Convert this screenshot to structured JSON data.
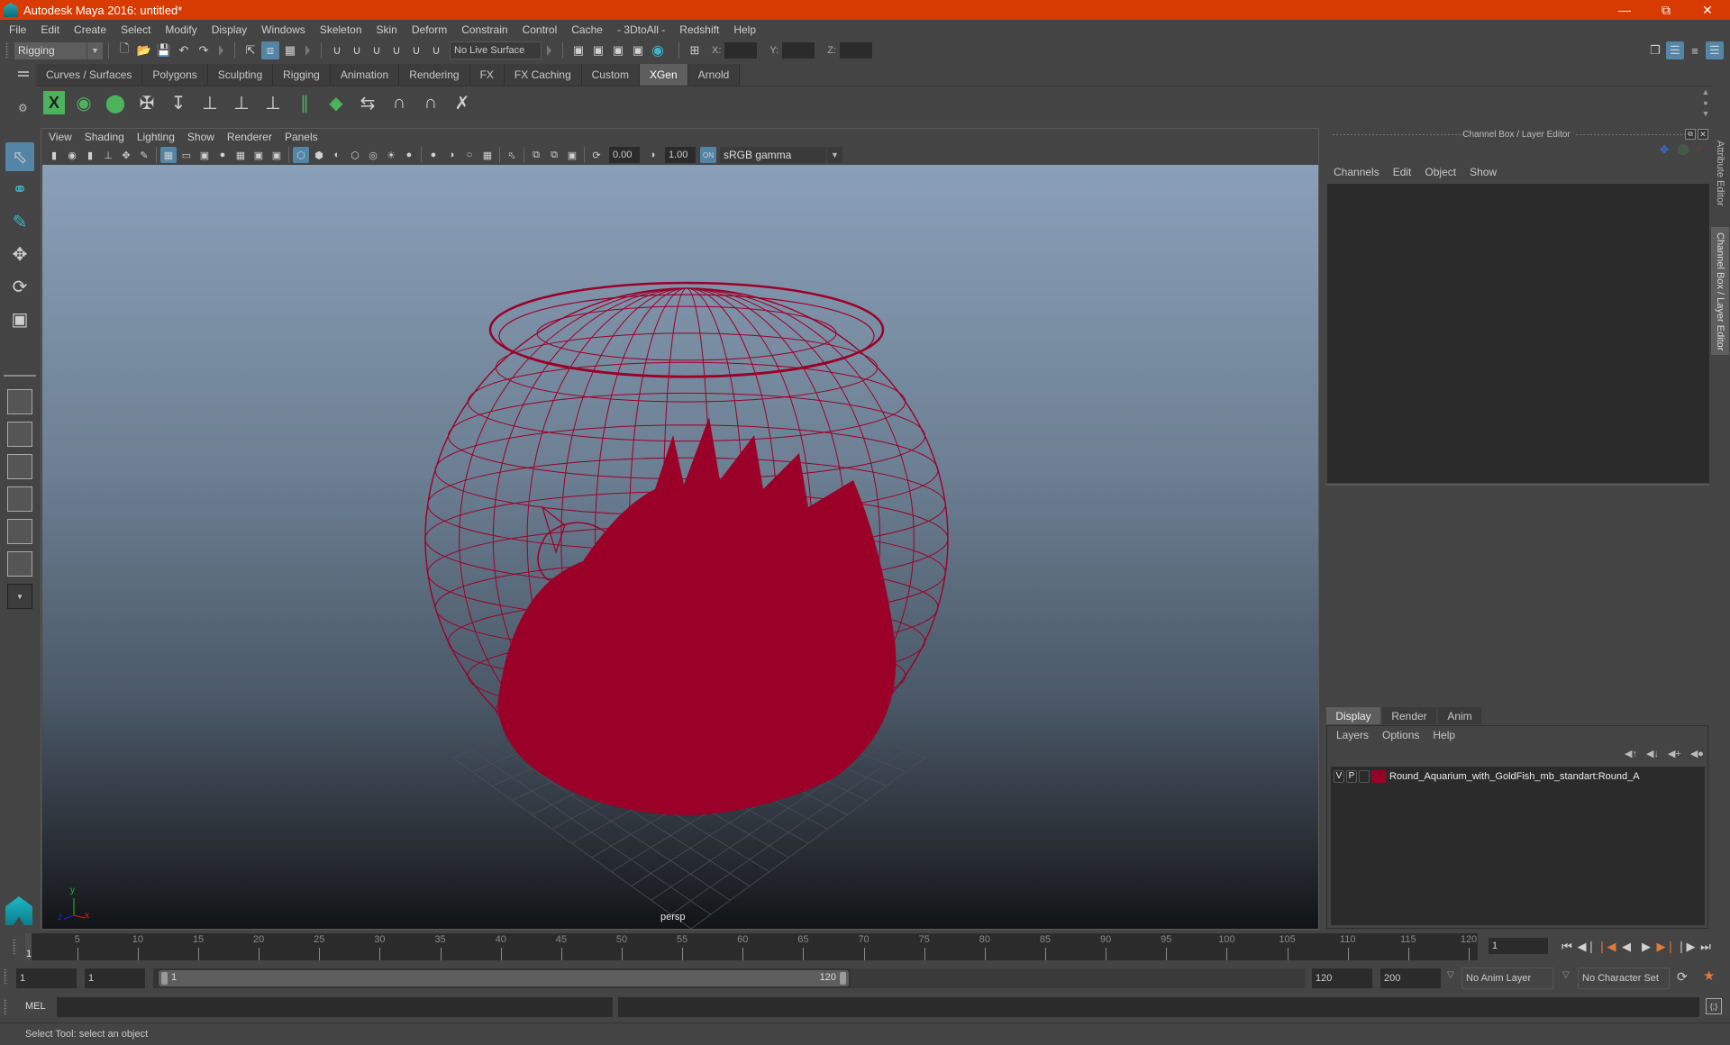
{
  "window": {
    "title": "Autodesk Maya 2016: untitled*",
    "controls": [
      "minimize",
      "restore",
      "close"
    ]
  },
  "menubar": [
    "File",
    "Edit",
    "Create",
    "Select",
    "Modify",
    "Display",
    "Windows",
    "Skeleton",
    "Skin",
    "Deform",
    "Constrain",
    "Control",
    "Cache",
    "- 3DtoAll -",
    "Redshift",
    "Help"
  ],
  "toolbar": {
    "menuset": "Rigging",
    "live_surface": "No Live Surface",
    "x_label": "X:",
    "y_label": "Y:",
    "z_label": "Z:",
    "x_value": "",
    "y_value": "",
    "z_value": ""
  },
  "shelf": {
    "tabs": [
      "Curves / Surfaces",
      "Polygons",
      "Sculpting",
      "Rigging",
      "Animation",
      "Rendering",
      "FX",
      "FX Caching",
      "Custom",
      "XGen",
      "Arnold"
    ],
    "active_tab": "XGen"
  },
  "viewport": {
    "menu": [
      "View",
      "Shading",
      "Lighting",
      "Show",
      "Renderer",
      "Panels"
    ],
    "exposure": "0.00",
    "gamma": "1.00",
    "color_space": "sRGB gamma",
    "camera_label": "persp",
    "axis_labels": {
      "x": "x",
      "y": "y",
      "z": "z"
    },
    "wireframe_color": "#9b0029",
    "scene_object": "Round aquarium with goldfish (wireframe)"
  },
  "channel_box": {
    "title": "Channel Box / Layer Editor",
    "menu": [
      "Channels",
      "Edit",
      "Object",
      "Show"
    ]
  },
  "layer_editor": {
    "tabs": [
      "Display",
      "Render",
      "Anim"
    ],
    "active_tab": "Display",
    "menu": [
      "Layers",
      "Options",
      "Help"
    ],
    "layers": [
      {
        "visible": "V",
        "playback": "P",
        "color": "#9b0029",
        "name": "Round_Aquarium_with_GoldFish_mb_standart:Round_A"
      }
    ]
  },
  "side_tabs": [
    "Attribute Editor",
    "Channel Box / Layer Editor"
  ],
  "timeline": {
    "ticks": [
      5,
      10,
      15,
      20,
      25,
      30,
      35,
      40,
      45,
      50,
      55,
      60,
      65,
      70,
      75,
      80,
      85,
      90,
      95,
      100,
      105,
      110,
      115,
      120
    ],
    "start": 1,
    "end": 120,
    "current_frame_marker": "1",
    "current_frame": "1"
  },
  "range": {
    "start_time": "1",
    "playback_start": "1",
    "slider_start": "1",
    "slider_end": "120",
    "playback_end": "120",
    "end_time": "200",
    "anim_layer": "No Anim Layer",
    "character_set": "No Character Set"
  },
  "command_line": {
    "label": "MEL",
    "value": "",
    "result": ""
  },
  "status": "Select Tool: select an object",
  "colors": {
    "titlebar": "#d83b01",
    "accent": "#5285a6",
    "active_key_orange": "#e07b39"
  }
}
